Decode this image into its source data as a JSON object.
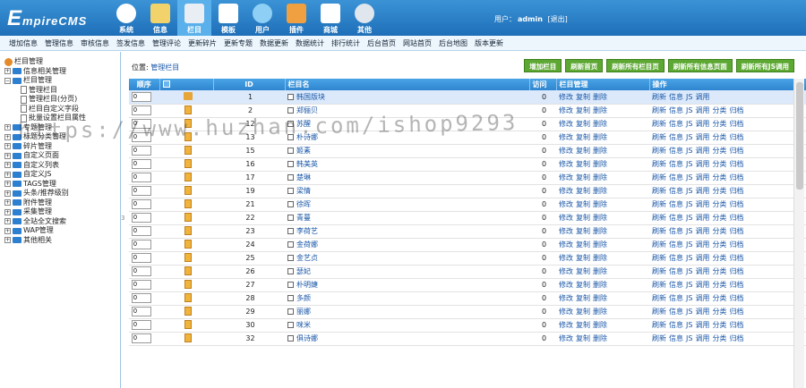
{
  "logo": {
    "big": "E",
    "rest": "mpireCMS"
  },
  "topnav": [
    {
      "label": "系统",
      "icon": "globe-icon",
      "color": "#ffffff"
    },
    {
      "label": "信息",
      "icon": "notepad-icon",
      "color": "#f2d36b"
    },
    {
      "label": "栏目",
      "icon": "folder-icon",
      "color": "#e9eef5"
    },
    {
      "label": "模板",
      "icon": "template-icon",
      "color": "#ffffff"
    },
    {
      "label": "用户",
      "icon": "user-icon",
      "color": "#8ed0f5"
    },
    {
      "label": "插件",
      "icon": "tools-icon",
      "color": "#f0a040"
    },
    {
      "label": "商城",
      "icon": "shop-icon",
      "color": "#ffffff"
    },
    {
      "label": "其他",
      "icon": "gear-icon",
      "color": "#dfe6ee"
    }
  ],
  "active_nav": 2,
  "user": {
    "prefix": "用户：",
    "name": "admin",
    "logout": "[退出]"
  },
  "menu": [
    "增加信息",
    "管理信息",
    "审核信息",
    "签发信息",
    "管理评论",
    "更新碎片",
    "更新专题",
    "数据更新",
    "数据统计",
    "排行统计",
    "后台首页",
    "网站首页",
    "后台地图",
    "版本更新"
  ],
  "tree": [
    {
      "label": "栏目管理",
      "type": "root",
      "indent": 0
    },
    {
      "label": "信息相关管理",
      "type": "folder",
      "indent": 0
    },
    {
      "label": "栏目管理",
      "type": "folder-open",
      "indent": 0
    },
    {
      "label": "管理栏目",
      "type": "page",
      "indent": 1
    },
    {
      "label": "管理栏目(分页)",
      "type": "page",
      "indent": 1
    },
    {
      "label": "栏目自定义字段",
      "type": "page",
      "indent": 1
    },
    {
      "label": "批量设置栏目属性",
      "type": "page",
      "indent": 1
    },
    {
      "label": "专题管理",
      "type": "folder",
      "indent": 0
    },
    {
      "label": "标题分类管理",
      "type": "folder",
      "indent": 0
    },
    {
      "label": "碎片管理",
      "type": "folder",
      "indent": 0
    },
    {
      "label": "自定义页面",
      "type": "folder",
      "indent": 0
    },
    {
      "label": "自定义列表",
      "type": "folder",
      "indent": 0
    },
    {
      "label": "自定义JS",
      "type": "folder",
      "indent": 0
    },
    {
      "label": "TAGS管理",
      "type": "folder",
      "indent": 0
    },
    {
      "label": "头条/推荐级别",
      "type": "folder",
      "indent": 0
    },
    {
      "label": "附件管理",
      "type": "folder",
      "indent": 0
    },
    {
      "label": "采集管理",
      "type": "folder",
      "indent": 0
    },
    {
      "label": "全站全文搜索",
      "type": "folder",
      "indent": 0
    },
    {
      "label": "WAP管理",
      "type": "folder",
      "indent": 0
    },
    {
      "label": "其他相关",
      "type": "folder",
      "indent": 0
    }
  ],
  "position": {
    "label": "位置:",
    "link": "管理栏目"
  },
  "buttons": [
    "增加栏目",
    "刷新首页",
    "刷新所有栏目页",
    "刷新所有信息页面",
    "刷新所有JS调用"
  ],
  "table": {
    "headers": [
      "顺序",
      "",
      "ID",
      "栏目名",
      "访问",
      "栏目管理",
      "操作"
    ],
    "manage_links": [
      "修改",
      "复制",
      "删除"
    ],
    "op_first": [
      "刷新",
      "信息",
      "JS",
      "调用"
    ],
    "op_rest": [
      "刷新",
      "信息",
      "JS",
      "调用",
      "分类",
      "归档"
    ],
    "rows": [
      {
        "order": "0",
        "id": "1",
        "name": "韩国版块",
        "visits": "0",
        "kind": "folder"
      },
      {
        "order": "0",
        "id": "2",
        "name": "郑俪贝",
        "visits": "0",
        "kind": "page"
      },
      {
        "order": "0",
        "id": "12",
        "name": "苏醒",
        "visits": "0",
        "kind": "page"
      },
      {
        "order": "0",
        "id": "13",
        "name": "朴诗娜",
        "visits": "0",
        "kind": "page"
      },
      {
        "order": "0",
        "id": "15",
        "name": "姬素",
        "visits": "0",
        "kind": "page"
      },
      {
        "order": "0",
        "id": "16",
        "name": "韩美英",
        "visits": "0",
        "kind": "page"
      },
      {
        "order": "0",
        "id": "17",
        "name": "楚琳",
        "visits": "0",
        "kind": "page"
      },
      {
        "order": "0",
        "id": "19",
        "name": "梁情",
        "visits": "0",
        "kind": "page"
      },
      {
        "order": "0",
        "id": "21",
        "name": "徐晖",
        "visits": "0",
        "kind": "page"
      },
      {
        "order": "0",
        "id": "22",
        "name": "青蔓",
        "visits": "0",
        "kind": "page"
      },
      {
        "order": "0",
        "id": "23",
        "name": "李荷艺",
        "visits": "0",
        "kind": "page"
      },
      {
        "order": "0",
        "id": "24",
        "name": "金荷娜",
        "visits": "0",
        "kind": "page"
      },
      {
        "order": "0",
        "id": "25",
        "name": "金艺贞",
        "visits": "0",
        "kind": "page"
      },
      {
        "order": "0",
        "id": "26",
        "name": "瑟妃",
        "visits": "0",
        "kind": "page"
      },
      {
        "order": "0",
        "id": "27",
        "name": "朴明婕",
        "visits": "0",
        "kind": "page"
      },
      {
        "order": "0",
        "id": "28",
        "name": "多颜",
        "visits": "0",
        "kind": "page"
      },
      {
        "order": "0",
        "id": "29",
        "name": "丽娜",
        "visits": "0",
        "kind": "page"
      },
      {
        "order": "0",
        "id": "30",
        "name": "咪米",
        "visits": "0",
        "kind": "page"
      },
      {
        "order": "0",
        "id": "32",
        "name": "俱诗娜",
        "visits": "0",
        "kind": "page"
      }
    ]
  },
  "watermark": "https://www.huzhan.com/ishop9293",
  "splitter": "3",
  "colors": {
    "header_blue": "#2f85cf",
    "button_green": "#5ca832",
    "link_blue": "#1a57a8",
    "selected_row": "#dbe9fb"
  }
}
